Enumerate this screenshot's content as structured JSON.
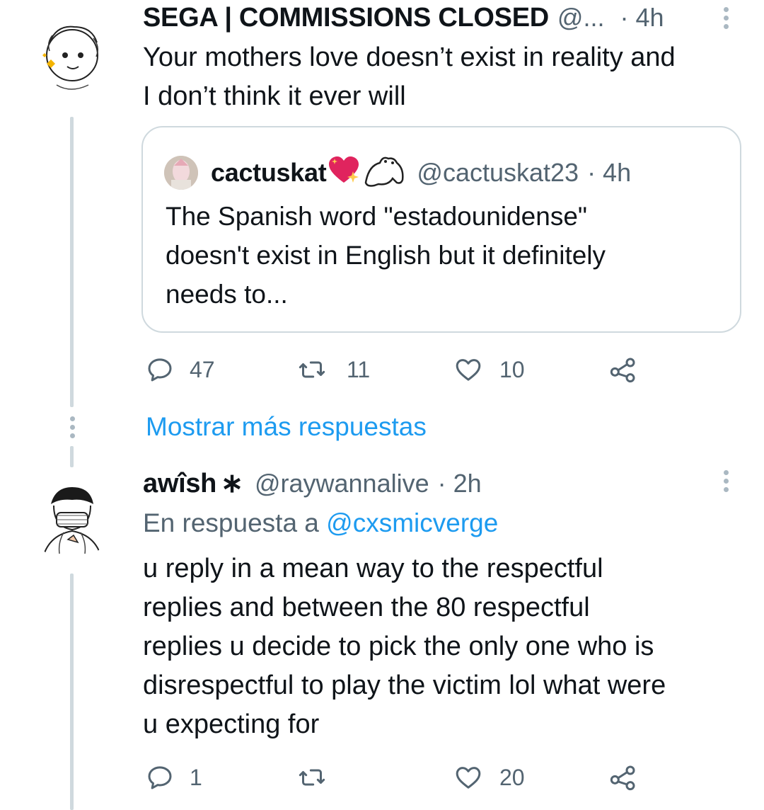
{
  "tweet1": {
    "display_name": "SEGA | COMMISSIONS CLOSED",
    "handle": "@...",
    "time": "· 4h",
    "text_line1": "Your mothers love doesn’t exist in reality and",
    "text_line2": "I don’t think it ever will",
    "quote": {
      "display_name": "cactuskat",
      "handle": "@cactuskat23",
      "time": "· 4h",
      "line1": "The Spanish word \"estadounidense\"",
      "line2": "doesn't exist in English but it definitely",
      "line3": "needs to..."
    },
    "actions": {
      "replies": "47",
      "retweets": "11",
      "likes": "10"
    }
  },
  "show_more": "Mostrar más respuestas",
  "tweet2": {
    "display_name": "awîsh",
    "handle": "@raywannalive",
    "time": "· 2h",
    "reply_prefix": "En respuesta a",
    "reply_to": "@cxsmicverge",
    "line1": "u reply in a mean way to the respectful",
    "line2": "replies and between the 80 respectful",
    "line3": "replies u decide to pick the only one who is",
    "line4": "disrespectful to play the victim lol what were",
    "line5": "u expecting for",
    "actions": {
      "replies": "1",
      "retweets": "",
      "likes": "20"
    }
  },
  "colors": {
    "link": "#1d9bf0",
    "secondary": "#536471",
    "line": "#cfd9de"
  }
}
